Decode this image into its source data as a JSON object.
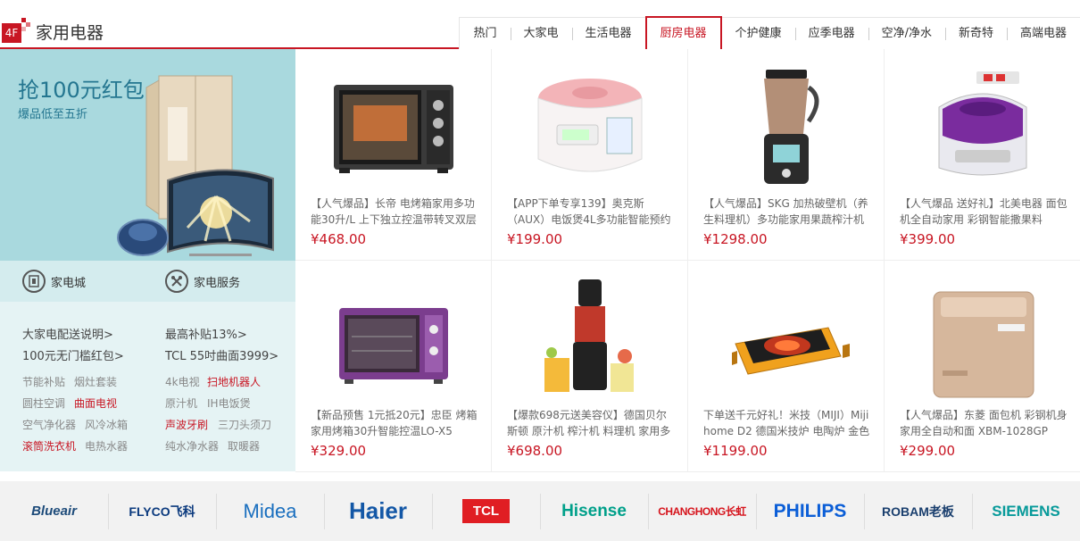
{
  "floor": {
    "badge": "4F",
    "title": "家用电器"
  },
  "tabs": [
    {
      "label": "热门"
    },
    {
      "label": "大家电"
    },
    {
      "label": "生活电器"
    },
    {
      "label": "厨房电器"
    },
    {
      "label": "个护健康"
    },
    {
      "label": "应季电器"
    },
    {
      "label": "空净/净水"
    },
    {
      "label": "新奇特"
    },
    {
      "label": "高端电器"
    }
  ],
  "active_tab": "厨房电器",
  "promo": {
    "title": "抢100元红包",
    "subtitle": "爆品低至五折"
  },
  "services": [
    {
      "label": "家电城",
      "icon": "store-icon"
    },
    {
      "label": "家电服务",
      "icon": "tools-icon"
    }
  ],
  "links": {
    "big": [
      "大家电配送说明>",
      "最高补贴13%>",
      "100元无门槛红包>",
      "TCL 55吋曲面3999>"
    ],
    "small": [
      "节能补贴",
      "烟灶套装",
      "4k电视",
      "扫地机器人",
      "圆柱空调",
      "曲面电视",
      "原汁机",
      "IH电饭煲",
      "空气净化器",
      "风冷冰箱",
      "声波牙刷",
      "三刀头须刀",
      "滚筒洗衣机",
      "电热水器",
      "纯水净水器",
      "取暖器"
    ]
  },
  "products": [
    {
      "name": "【人气爆品】长帝 电烤箱家用多功能30升/L 上下独立控温带转叉双层",
      "price": "¥468.00",
      "icon": "oven-icon"
    },
    {
      "name": "【APP下单专享139】奥克斯（AUX）电饭煲4L多功能智能预约",
      "price": "¥199.00",
      "icon": "rice-cooker-icon"
    },
    {
      "name": "【人气爆品】SKG 加热破壁机（养生料理机）多功能家用果蔬榨汁机",
      "price": "¥1298.00",
      "icon": "blender-icon"
    },
    {
      "name": "【人气爆品 送好礼】北美电器 面包机全自动家用 彩钢智能撒果料",
      "price": "¥399.00",
      "icon": "bread-maker-purple-icon"
    },
    {
      "name": "【新品预售 1元抵20元】忠臣 烤箱家用烤箱30升智能控温LO-X5",
      "price": "¥329.00",
      "icon": "oven-purple-icon"
    },
    {
      "name": "【爆款698元送美容仪】德国贝尔斯顿 原汁机 榨汁机 料理机 家用多",
      "price": "¥698.00",
      "icon": "juicer-icon"
    },
    {
      "name": "下单送千元好礼！米技（MIJI）Miji home D2 德国米技炉 电陶炉 金色",
      "price": "¥1199.00",
      "icon": "induction-cooker-icon"
    },
    {
      "name": "【人气爆品】东菱 面包机 彩钢机身 家用全自动和面 XBM-1028GP",
      "price": "¥299.00",
      "icon": "bread-maker-gold-icon"
    }
  ],
  "brands": [
    {
      "name": "Blueair",
      "color": "#1d4b7a"
    },
    {
      "name": "FLYCO飞科",
      "color": "#0b3a7e"
    },
    {
      "name": "Midea",
      "color": "#1a6fbf"
    },
    {
      "name": "Haier",
      "color": "#1357a6"
    },
    {
      "name": "TCL",
      "color": "#e01e23"
    },
    {
      "name": "Hisense",
      "color": "#00a08a"
    },
    {
      "name": "CHANGHONG长虹",
      "color": "#d6141c"
    },
    {
      "name": "PHILIPS",
      "color": "#0b5ed7"
    },
    {
      "name": "ROBAM老板",
      "color": "#1a3f6e"
    },
    {
      "name": "SIEMENS",
      "color": "#079a9a"
    }
  ]
}
